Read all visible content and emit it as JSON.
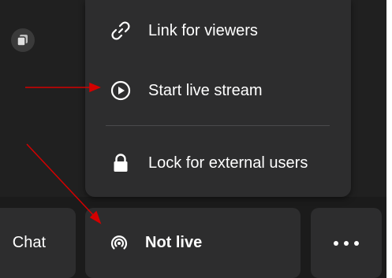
{
  "menu": {
    "items": [
      {
        "label": "Link for viewers",
        "icon": "link-icon"
      },
      {
        "label": "Start live stream",
        "icon": "play-circle-icon"
      },
      {
        "label": "Lock for external users",
        "icon": "lock-icon"
      }
    ]
  },
  "toolbar": {
    "chat_label": "Chat",
    "live_label": "Not live",
    "live_icon": "broadcast-icon",
    "more_icon": "more-dots-icon"
  },
  "colors": {
    "background": "#202020",
    "menu_bg": "#2d2d2e",
    "tile_bg": "#2d2d2e",
    "text": "#ffffff",
    "annotation_arrow": "#d40000"
  }
}
